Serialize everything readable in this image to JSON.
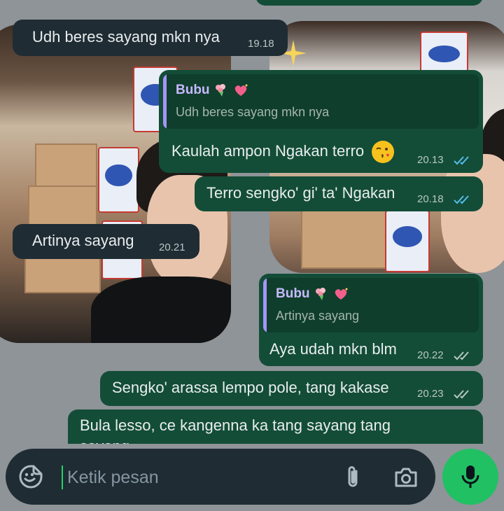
{
  "conversation": {
    "messages": [
      {
        "id": "m1",
        "direction": "in",
        "text": "Udh beres sayang mkn nya",
        "time": "19.18"
      },
      {
        "id": "m2",
        "direction": "out",
        "quote": {
          "name": "Bubu",
          "text": "Udh beres sayang mkn nya"
        },
        "text": "Kaulah ampon Ngakan terro",
        "time": "20.13",
        "status": "read"
      },
      {
        "id": "m3",
        "direction": "out",
        "text": "Terro sengko' gi' ta' Ngakan",
        "time": "20.18",
        "status": "read"
      },
      {
        "id": "m4",
        "direction": "in",
        "text": "Artinya sayang",
        "time": "20.21"
      },
      {
        "id": "m5",
        "direction": "out",
        "quote": {
          "name": "Bubu",
          "text": "Artinya sayang"
        },
        "text": "Aya udah mkn blm",
        "time": "20.22",
        "status": "delivered"
      },
      {
        "id": "m6",
        "direction": "out",
        "text": "Sengko' arassa lempo pole, tang kakase",
        "time": "20.23",
        "status": "delivered"
      },
      {
        "id": "m7",
        "direction": "out",
        "text": "Bula lesso, ce kangenna ka tang  sayang tang",
        "text_cut": "sayang"
      }
    ]
  },
  "composer": {
    "placeholder": "Ketik pesan",
    "icons": {
      "emoji": "emoji-sticker-icon",
      "attach": "paperclip-icon",
      "camera": "camera-icon",
      "mic": "microphone-icon"
    }
  },
  "colors": {
    "incoming": "#1f2c34",
    "outgoing": "#134d37",
    "quote_name": "#c7b9ff",
    "read_tick": "#53bdeb",
    "accent": "#21c063"
  }
}
